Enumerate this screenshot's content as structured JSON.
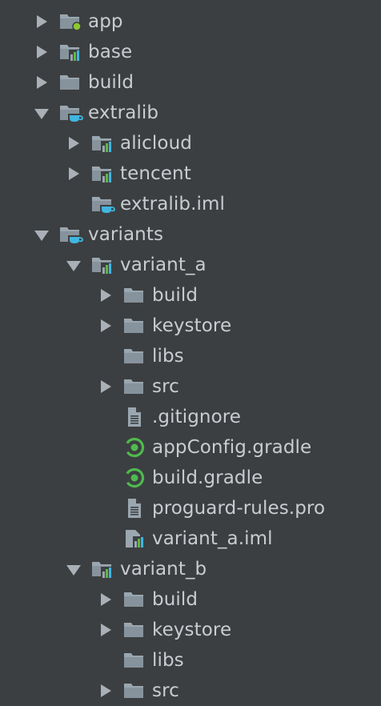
{
  "tree": [
    {
      "label": "app",
      "depth": 0,
      "arrow": "collapsed",
      "icon": "folder-module-app-icon"
    },
    {
      "label": "base",
      "depth": 0,
      "arrow": "collapsed",
      "icon": "folder-module-icon"
    },
    {
      "label": "build",
      "depth": 0,
      "arrow": "collapsed",
      "icon": "folder-icon"
    },
    {
      "label": "extralib",
      "depth": 0,
      "arrow": "expanded",
      "icon": "folder-cup-icon"
    },
    {
      "label": "alicloud",
      "depth": 1,
      "arrow": "collapsed",
      "icon": "folder-module-icon"
    },
    {
      "label": "tencent",
      "depth": 1,
      "arrow": "collapsed",
      "icon": "folder-module-icon"
    },
    {
      "label": "extralib.iml",
      "depth": 1,
      "arrow": "none",
      "icon": "folder-cup-icon"
    },
    {
      "label": "variants",
      "depth": 0,
      "arrow": "expanded",
      "icon": "folder-cup-icon"
    },
    {
      "label": "variant_a",
      "depth": 1,
      "arrow": "expanded",
      "icon": "folder-module-icon"
    },
    {
      "label": "build",
      "depth": 2,
      "arrow": "collapsed",
      "icon": "folder-icon"
    },
    {
      "label": "keystore",
      "depth": 2,
      "arrow": "collapsed",
      "icon": "folder-icon"
    },
    {
      "label": "libs",
      "depth": 2,
      "arrow": "none",
      "icon": "folder-icon"
    },
    {
      "label": "src",
      "depth": 2,
      "arrow": "collapsed",
      "icon": "folder-icon"
    },
    {
      "label": ".gitignore",
      "depth": 2,
      "arrow": "none",
      "icon": "text-file-icon"
    },
    {
      "label": "appConfig.gradle",
      "depth": 2,
      "arrow": "none",
      "icon": "gradle-icon"
    },
    {
      "label": "build.gradle",
      "depth": 2,
      "arrow": "none",
      "icon": "gradle-icon"
    },
    {
      "label": "proguard-rules.pro",
      "depth": 2,
      "arrow": "none",
      "icon": "text-file-icon"
    },
    {
      "label": "variant_a.iml",
      "depth": 2,
      "arrow": "none",
      "icon": "module-file-icon"
    },
    {
      "label": "variant_b",
      "depth": 1,
      "arrow": "expanded",
      "icon": "folder-module-icon"
    },
    {
      "label": "build",
      "depth": 2,
      "arrow": "collapsed",
      "icon": "folder-icon"
    },
    {
      "label": "keystore",
      "depth": 2,
      "arrow": "collapsed",
      "icon": "folder-icon"
    },
    {
      "label": "libs",
      "depth": 2,
      "arrow": "none",
      "icon": "folder-icon"
    },
    {
      "label": "src",
      "depth": 2,
      "arrow": "collapsed",
      "icon": "folder-icon"
    }
  ],
  "colors": {
    "background": "#3c3f41",
    "text": "#c9cdd1",
    "arrow": "#a9b0b7",
    "folder": "#9aa7b0",
    "folder_shade": "#87939c",
    "file": "#9aa7b0",
    "bar_green": "#62b543",
    "bar_blue": "#40b6e0",
    "bar_gray": "#9aa7b0",
    "cup_blue": "#40b6e0",
    "gradle_green": "#4fba4e",
    "app_dot_green": "#8cc832"
  }
}
